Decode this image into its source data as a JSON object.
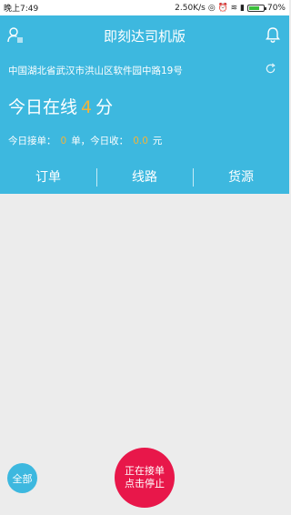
{
  "status_bar": {
    "time": "晚上7:49",
    "speed": "2.50K/s",
    "battery_percent": "70%",
    "battery_level": 0.7
  },
  "header": {
    "title": "即刻达司机版",
    "address": "中国湖北省武汉市洪山区软件园中路19号",
    "online_prefix": "今日在线",
    "online_value": "4",
    "online_unit": "分",
    "orders_label": "今日接单：",
    "orders_value": "0",
    "orders_unit": "单，今日收：",
    "income_value": "0.0",
    "income_unit": "元"
  },
  "tabs": [
    {
      "label": "订单"
    },
    {
      "label": "线路"
    },
    {
      "label": "货源"
    }
  ],
  "buttons": {
    "all_label": "全部",
    "stop_line1": "正在接单",
    "stop_line2": "点击停止"
  },
  "colors": {
    "primary": "#3db8df",
    "accent": "#f2b43a",
    "stop": "#e8174a",
    "background": "#ececec"
  },
  "icons": [
    "user-icon",
    "bell-icon",
    "refresh-icon"
  ]
}
